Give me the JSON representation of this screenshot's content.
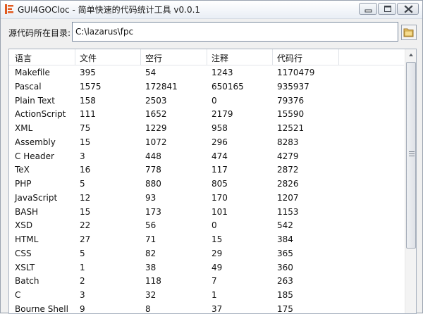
{
  "window": {
    "title": "GUI4GOCloc - 简单快速的代码统计工具 v0.0.1",
    "accent": "#e15a1f"
  },
  "directory": {
    "label": "源代码所在目录:",
    "value": "C:\\lazarus\\fpc"
  },
  "table": {
    "columns": [
      "语言",
      "文件",
      "空行",
      "注释",
      "代码行"
    ],
    "rows": [
      [
        "Makefile",
        "395",
        "54",
        "1243",
        "1170479"
      ],
      [
        "Pascal",
        "1575",
        "172841",
        "650165",
        "935937"
      ],
      [
        "Plain Text",
        "158",
        "2503",
        "0",
        "79376"
      ],
      [
        "ActionScript",
        "111",
        "1652",
        "2179",
        "15590"
      ],
      [
        "XML",
        "75",
        "1229",
        "958",
        "12521"
      ],
      [
        "Assembly",
        "15",
        "1072",
        "296",
        "8283"
      ],
      [
        "C Header",
        "3",
        "448",
        "474",
        "4279"
      ],
      [
        "TeX",
        "16",
        "778",
        "117",
        "2872"
      ],
      [
        "PHP",
        "5",
        "880",
        "805",
        "2826"
      ],
      [
        "JavaScript",
        "12",
        "93",
        "170",
        "1207"
      ],
      [
        "BASH",
        "15",
        "173",
        "101",
        "1153"
      ],
      [
        "XSD",
        "22",
        "56",
        "0",
        "542"
      ],
      [
        "HTML",
        "27",
        "71",
        "15",
        "384"
      ],
      [
        "CSS",
        "5",
        "82",
        "29",
        "365"
      ],
      [
        "XSLT",
        "1",
        "38",
        "49",
        "360"
      ],
      [
        "Batch",
        "2",
        "118",
        "7",
        "263"
      ],
      [
        "C",
        "3",
        "32",
        "1",
        "185"
      ],
      [
        "Bourne Shell",
        "9",
        "8",
        "37",
        "175"
      ]
    ]
  },
  "icons": {
    "app": "app-logo-icon",
    "minimize": "minimize-icon",
    "maximize": "maximize-icon",
    "close": "close-icon",
    "browse": "folder-icon"
  }
}
